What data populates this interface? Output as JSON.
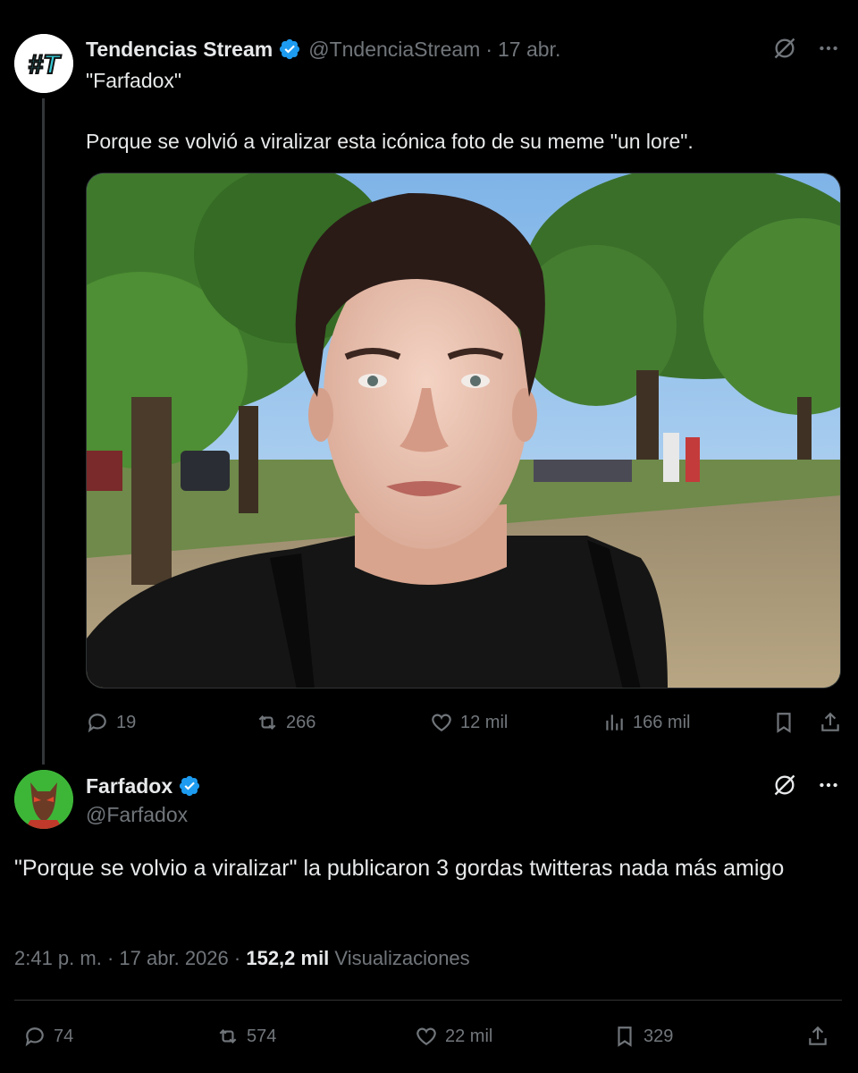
{
  "thread": {
    "tweet1": {
      "display_name": "Tendencias Stream",
      "handle": "@TndenciaStream",
      "separator": "·",
      "date": "17 abr.",
      "avatar_text": "#T",
      "text_line1": "\"Farfadox\"",
      "text_line2": "Porque se volvió a viralizar esta icónica foto de su meme \"un lore\".",
      "media_alt_icon": "selfie-photo",
      "actions": {
        "replies": "19",
        "reposts": "266",
        "likes": "12 mil",
        "views": "166 mil"
      }
    },
    "tweet2": {
      "display_name": "Farfadox",
      "handle": "@Farfadox",
      "text": "\"Porque se volvio a viralizar\" la publicaron 3 gordas twitteras nada más amigo",
      "time": "2:41 p. m.",
      "separator1": "·",
      "date": "17 abr. 2026",
      "separator2": "·",
      "views_count": "152,2 mil",
      "views_label": "Visualizaciones",
      "actions": {
        "replies": "74",
        "reposts": "574",
        "likes": "22 mil",
        "bookmarks": "329"
      }
    }
  },
  "colors": {
    "background": "#000000",
    "text": "#e7e9ea",
    "muted": "#71767b",
    "verified": "#1d9bf0",
    "avatar2_bg": "#3db638"
  },
  "icons": [
    "verified-icon",
    "grok-icon",
    "more-icon",
    "reply-icon",
    "repost-icon",
    "like-icon",
    "views-icon",
    "bookmark-icon",
    "share-icon"
  ]
}
